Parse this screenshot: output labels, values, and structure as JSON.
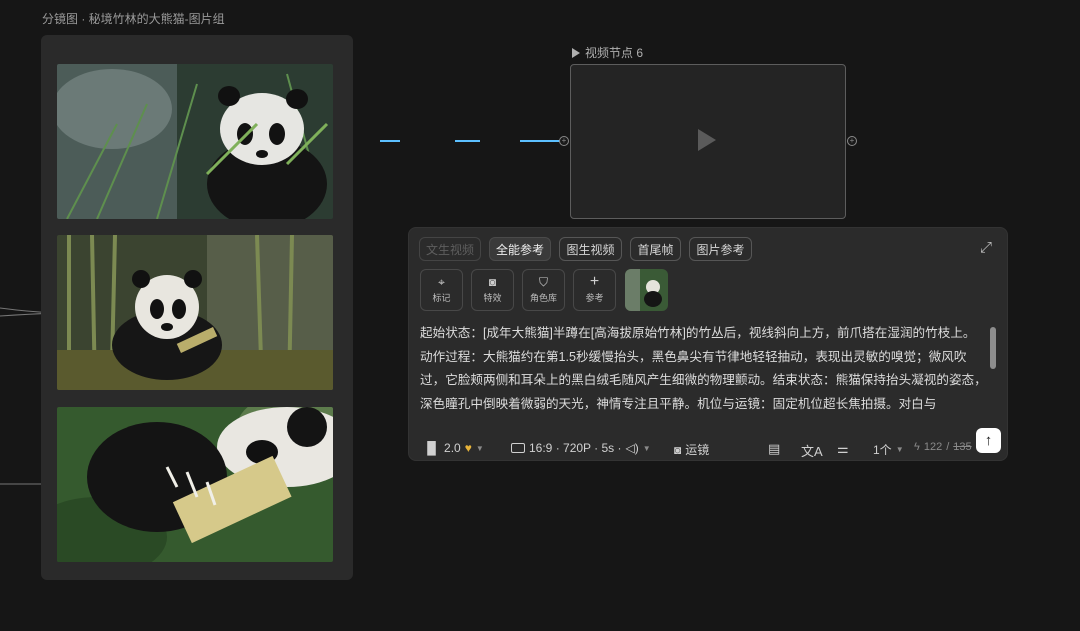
{
  "group": {
    "title": "分镜图 · 秘境竹林的大熊猫-图片组"
  },
  "video_node": {
    "label": "视频节点 6",
    "play_icon": "play-icon"
  },
  "tabs": [
    {
      "label": "文生视频",
      "state": "disabled"
    },
    {
      "label": "全能参考",
      "state": "active"
    },
    {
      "label": "图生视频",
      "state": "normal"
    },
    {
      "label": "首尾帧",
      "state": "normal"
    },
    {
      "label": "图片参考",
      "state": "normal"
    }
  ],
  "tools": [
    {
      "label": "标记",
      "icon": "pin-plus-icon"
    },
    {
      "label": "特效",
      "icon": "camera-icon"
    },
    {
      "label": "角色库",
      "icon": "shield-icon"
    },
    {
      "label": "参考",
      "icon": "plus-icon"
    }
  ],
  "prompt": "起始状态：[成年大熊猫]半蹲在[高海拔原始竹林]的竹丛后，视线斜向上方，前爪搭在湿润的竹枝上。动作过程：大熊猫约在第1.5秒缓慢抬头，黑色鼻尖有节律地轻轻抽动，表现出灵敏的嗅觉；微风吹过，它脸颊两侧和耳朵上的黑白绒毛随风产生细微的物理颤动。结束状态：熊猫保持抬头凝视的姿态，深色瞳孔中倒映着微弱的天光，神情专注且平静。机位与运镜：固定机位超长焦拍摄。对白与",
  "bottom_bar": {
    "model": "2.0",
    "aspect_info": "16:9 · 720P · 5s ·",
    "camera_label": "运镜",
    "count": "1个",
    "credits_used": "122",
    "separator": "/",
    "credits_total": "135"
  },
  "colors": {
    "background": "#161616",
    "panel": "#2b2b2b",
    "accent_line": "#3fa9f5",
    "badge_gold": "#e8b43a",
    "send_button": "#ffffff"
  }
}
